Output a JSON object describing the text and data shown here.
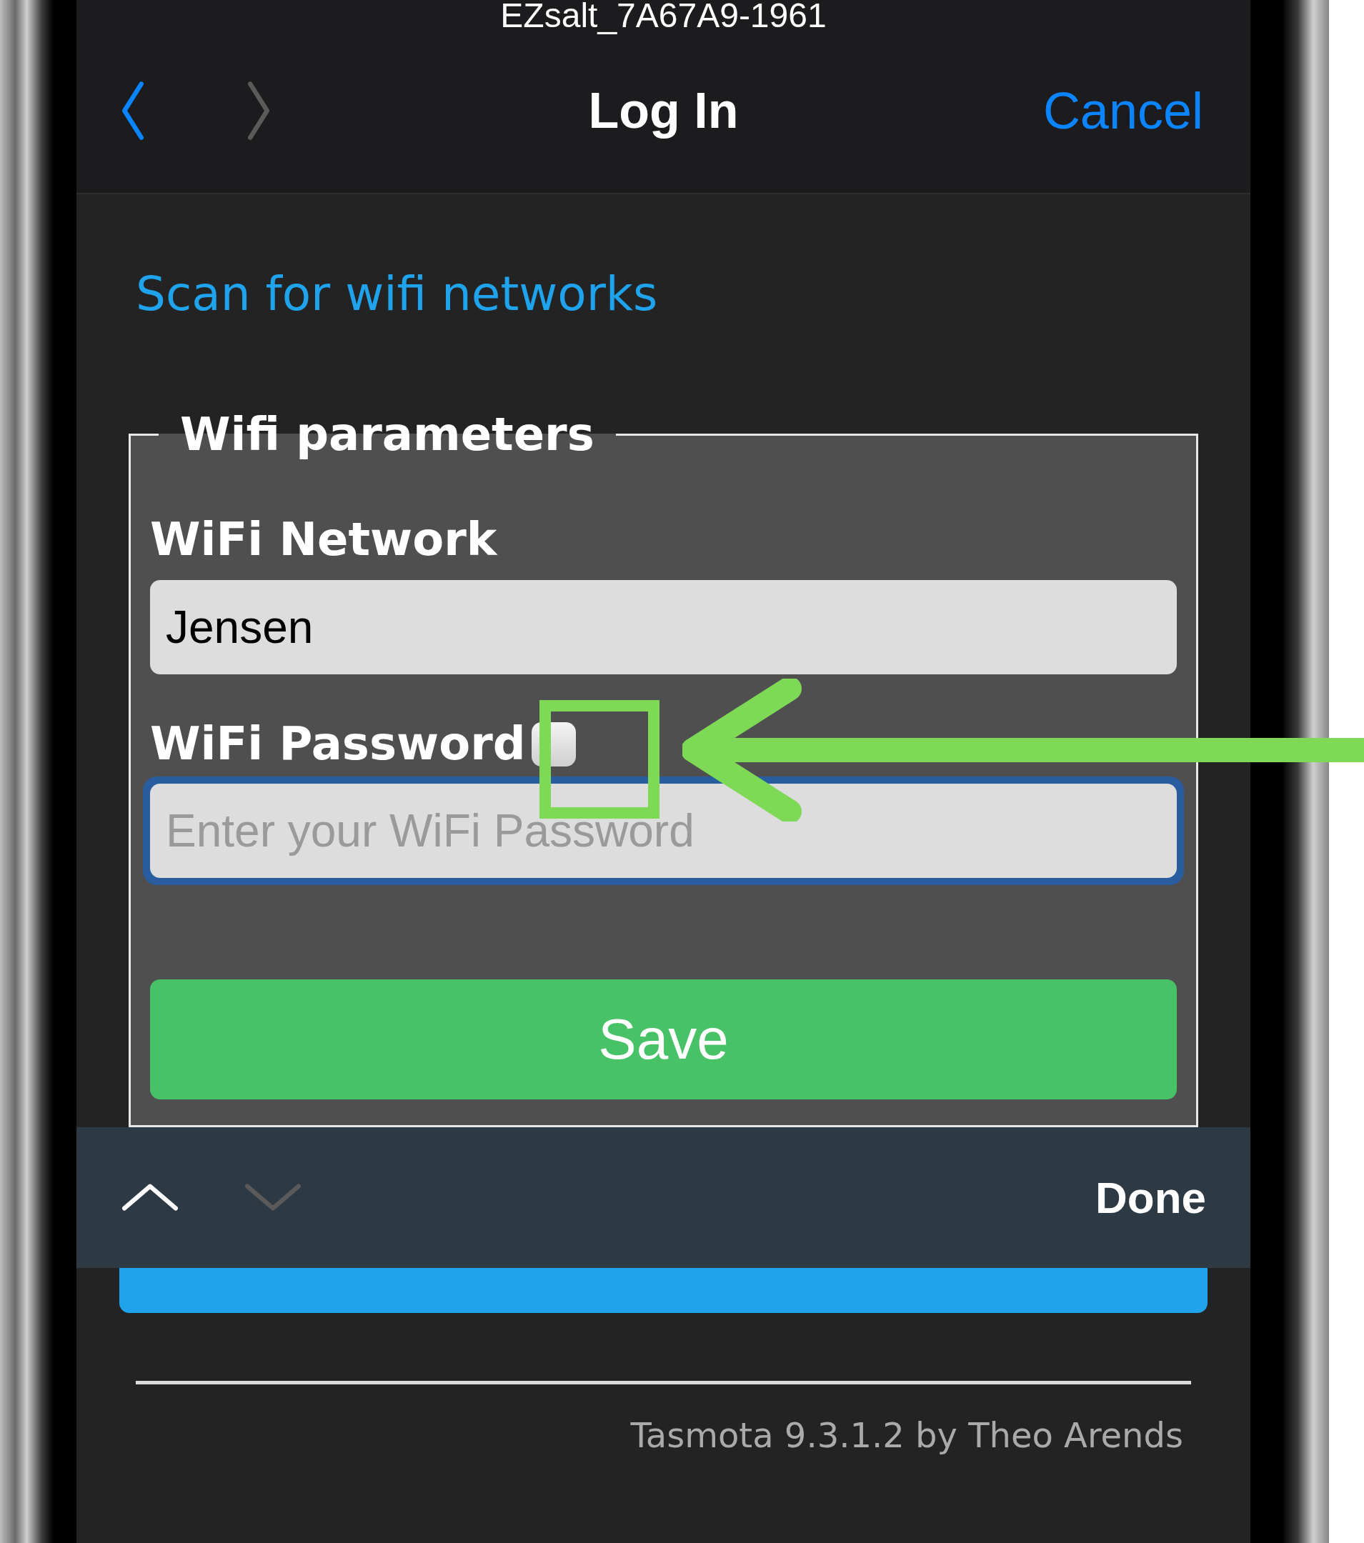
{
  "page_title": "EZsalt_7A67A9-1961",
  "nav": {
    "back_enabled": true,
    "forward_enabled": false,
    "title": "Log In",
    "cancel": "Cancel"
  },
  "scan_link": "Scan for wifi networks",
  "fieldset": {
    "legend": "Wifi parameters",
    "fields": [
      {
        "label": "WiFi Network",
        "value": "Jensen",
        "focused": false
      },
      {
        "label": "WiFi Password",
        "placeholder": "Enter your WiFi Password",
        "focused": true,
        "show_password": {
          "checked": false
        }
      }
    ],
    "save": "Save"
  },
  "accessory_bar": {
    "previous_enabled": true,
    "next_enabled": false,
    "done": "Done"
  },
  "footer": "Tasmota 9.3.1.2 by Theo Arends"
}
